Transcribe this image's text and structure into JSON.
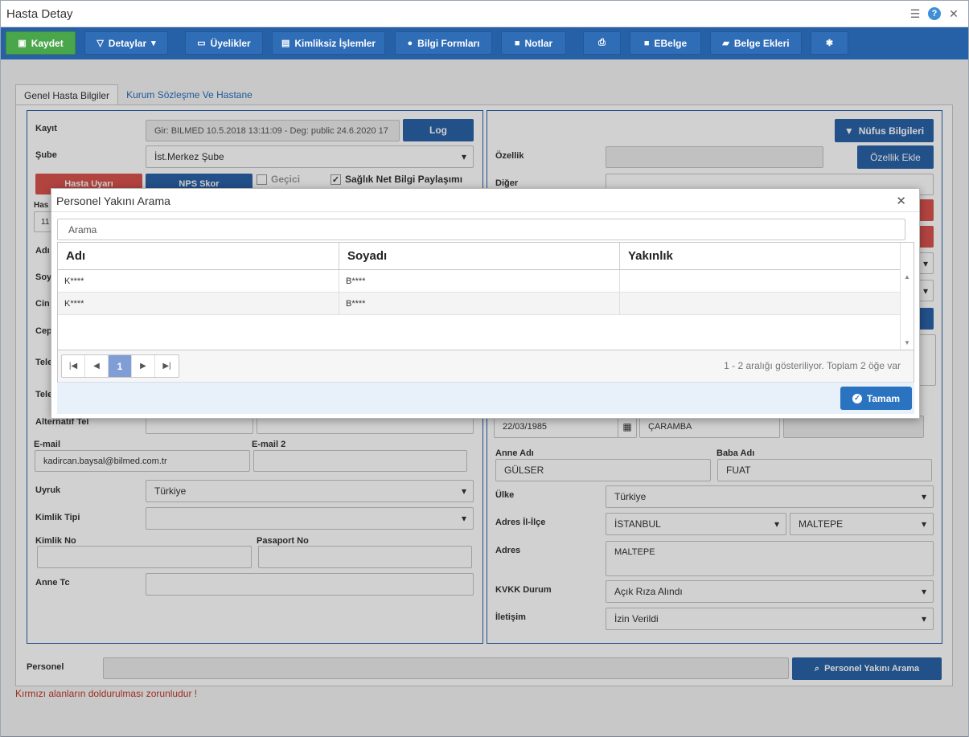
{
  "window": {
    "title": "Hasta Detay"
  },
  "toolbar": {
    "save": "Kaydet",
    "details": "Detaylar",
    "memberships": "Üyelikler",
    "anon_ops": "Kimliksiz İşlemler",
    "info_forms": "Bilgi Formları",
    "notes": "Notlar",
    "ebelge": "EBelge",
    "attachments": "Belge Ekleri"
  },
  "tabs": [
    "Genel Hasta Bilgiler",
    "Kurum Sözleşme Ve Hastane"
  ],
  "left": {
    "kayit_label": "Kayıt",
    "kayit_value": "Gir: BILMED  10.5.2018 13:11:09 - Deg: public  24.6.2020 17",
    "log_btn": "Log",
    "sube_label": "Şube",
    "sube_value": "İst.Merkez Şube",
    "hasta_uyari": "Hasta Uyarı",
    "nps_skor": "NPS Skor",
    "gecici": "Geçici",
    "saglik_net": "Sağlık Net Bilgi Paylaşımı",
    "partial_labels": [
      "Has",
      "Adı",
      "Soy",
      "Cin",
      "Cep",
      "Tele",
      "Tele"
    ],
    "partial_value": "11",
    "alt_tel_label": "Alternatif Tel",
    "email_label": "E-mail",
    "email_value": "kadircan.baysal@bilmed.com.tr",
    "email2_label": "E-mail 2",
    "uyruk_label": "Uyruk",
    "uyruk_value": "Türkiye",
    "kimlik_tipi_label": "Kimlik Tipi",
    "kimlik_no_label": "Kimlik No",
    "pasaport_label": "Pasaport No",
    "anne_tc_label": "Anne Tc"
  },
  "right": {
    "nufus_btn": "Nüfus Bilgileri",
    "ozellik_label": "Özellik",
    "ozellik_ekle": "Özellik Ekle",
    "diger_label": "Diğer",
    "birth_date": "22/03/1985",
    "birth_place": "ÇARAMBA",
    "anne_adi_label": "Anne Adı",
    "anne_adi": "GÜLSER",
    "baba_adi_label": "Baba Adı",
    "baba_adi": "FUAT",
    "ulke_label": "Ülke",
    "ulke": "Türkiye",
    "adres_il_label": "Adres İl-İlçe",
    "il": "İSTANBUL",
    "ilce": "MALTEPE",
    "adres_label": "Adres",
    "adres": "MALTEPE",
    "kvkk_label": "KVKK Durum",
    "kvkk": "Açık Rıza Alındı",
    "iletisim_label": "İletişim",
    "iletisim": "İzin Verildi"
  },
  "bottom": {
    "personel_label": "Personel",
    "personel_btn": "Personel Yakını Arama",
    "required_note": "Kırmızı alanların doldurulması zorunludur !"
  },
  "modal": {
    "title": "Personel Yakını Arama",
    "search_placeholder": "Arama",
    "columns": [
      "Adı",
      "Soyadı",
      "Yakınlık"
    ],
    "rows": [
      {
        "adi": "K****",
        "soyadi": "B****",
        "yakinlik": ""
      },
      {
        "adi": "K****",
        "soyadi": "B****",
        "yakinlik": ""
      }
    ],
    "current_page": "1",
    "page_info": "1 - 2 aralığı gösteriliyor. Toplam 2 öğe var",
    "ok": "Tamam"
  }
}
